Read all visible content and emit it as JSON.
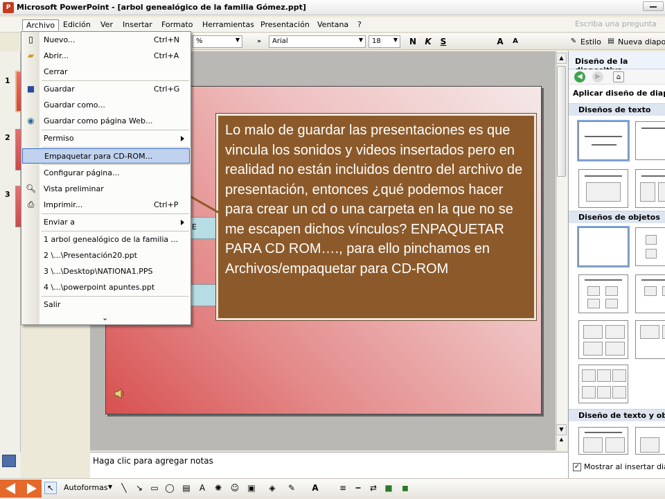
{
  "window": {
    "title": "Microsoft PowerPoint - [arbol genealógico de la familia Gómez.ppt]",
    "app_icon": "powerpoint-icon"
  },
  "menubar": {
    "items": [
      "Archivo",
      "Edición",
      "Ver",
      "Insertar",
      "Formato",
      "Herramientas",
      "Presentación",
      "Ventana",
      "?"
    ],
    "active": "Archivo",
    "help_placeholder": "Escriba una pregunta"
  },
  "toolbar": {
    "zoom_partial": "%",
    "font": "Arial",
    "size": "18",
    "bold": "N",
    "italic": "K",
    "underline": "S",
    "style_label": "Estilo",
    "new_slide_label": "Nueva diapos"
  },
  "file_menu": {
    "items": [
      {
        "label": "Nuevo...",
        "shortcut": "Ctrl+N",
        "icon": "new-document-icon"
      },
      {
        "label": "Abrir...",
        "shortcut": "Ctrl+A",
        "icon": "open-folder-icon"
      },
      {
        "label": "Cerrar",
        "shortcut": "",
        "icon": ""
      },
      {
        "label": "Guardar",
        "shortcut": "Ctrl+G",
        "icon": "save-disk-icon"
      },
      {
        "label": "Guardar como...",
        "shortcut": "",
        "icon": ""
      },
      {
        "label": "Guardar como página Web...",
        "shortcut": "",
        "icon": "web-page-icon"
      },
      {
        "label": "Permiso",
        "shortcut": "",
        "icon": ""
      },
      {
        "label": "Empaquetar para CD-ROM...",
        "shortcut": "",
        "icon": ""
      },
      {
        "label": "Configurar página...",
        "shortcut": "",
        "icon": ""
      },
      {
        "label": "Vista preliminar",
        "shortcut": "",
        "icon": "print-preview-icon"
      },
      {
        "label": "Imprimir...",
        "shortcut": "Ctrl+P",
        "icon": "printer-icon"
      },
      {
        "label": "Enviar a",
        "shortcut": "",
        "icon": ""
      },
      {
        "label": "1 arbol genealógico de la familia ...",
        "shortcut": "",
        "icon": ""
      },
      {
        "label": "2 \\...\\Presentación20.ppt",
        "shortcut": "",
        "icon": ""
      },
      {
        "label": "3 \\...\\Desktop\\NATIONA1.PPS",
        "shortcut": "",
        "icon": ""
      },
      {
        "label": "4 \\...\\powerpoint apuntes.ppt",
        "shortcut": "",
        "icon": ""
      },
      {
        "label": "Salir",
        "shortcut": "",
        "icon": ""
      }
    ],
    "highlighted": "Empaquetar para CD-ROM...",
    "expand_glyph": "⌄"
  },
  "thumbnails": [
    "1",
    "2",
    "3"
  ],
  "slide": {
    "bar_text": "E"
  },
  "callout": {
    "text": "Lo malo de guardar las presentaciones es que vincula los sonidos y videos insertados pero en realidad no están incluidos dentro del archivo de presentación, entonces ¿qué podemos hacer para crear un cd o una carpeta en la que no se me escapen dichos vínculos? ENPAQUETAR PARA CD ROM…., para ello pinchamos en Archivos/empaquetar para CD-ROM",
    "bg_color": "#8c5a2a"
  },
  "notes": {
    "placeholder": "Haga clic para agregar notas"
  },
  "task_pane": {
    "title": "Diseño de la diapositiva",
    "apply_label": "Aplicar diseño de diapos",
    "section_text": "Diseños de texto",
    "section_objects": "Diseños de objetos",
    "section_text_objects": "Diseño de texto y obje",
    "show_on_insert": "Mostrar al insertar diapo"
  },
  "drawing_toolbar": {
    "autoformas": "Autoformas"
  },
  "colors": {
    "accent_orange": "#e4692a",
    "menu_highlight": "#c1d2ee",
    "slide_red": "#d85050"
  }
}
